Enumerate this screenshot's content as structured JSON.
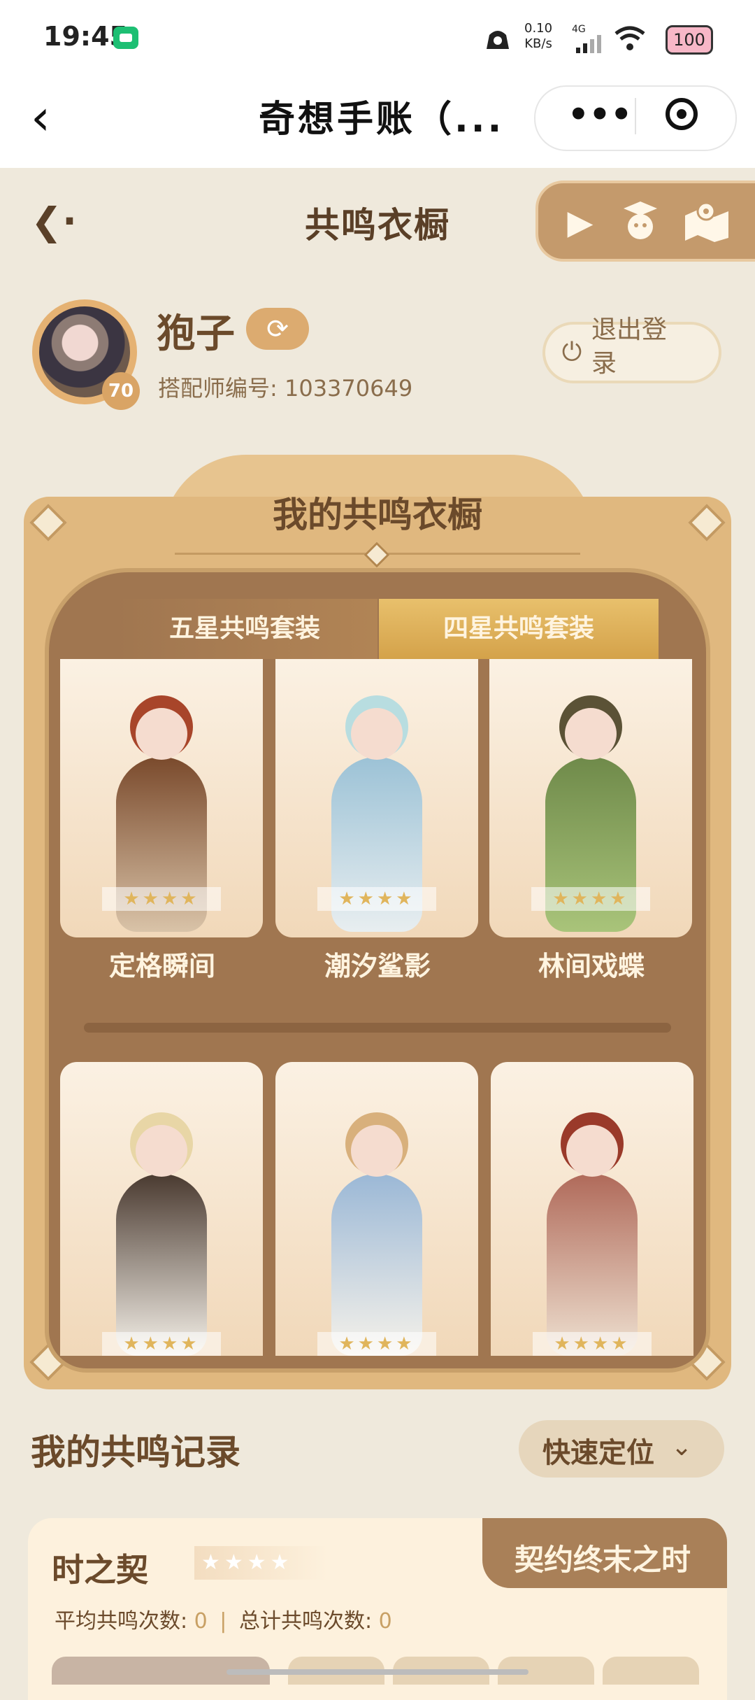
{
  "status_bar": {
    "time": "19:45",
    "net_speed_value": "0.10",
    "net_speed_unit": "KB/s",
    "signal": "4G",
    "battery": "100"
  },
  "header": {
    "back_icon": "chevron-left-icon",
    "title": "奇想手账（...",
    "more_icon": "more-dots-icon",
    "target_icon": "target-icon"
  },
  "page": {
    "title": "共鸣衣橱",
    "back_icon": "arrow-back-icon"
  },
  "toolbar": {
    "icons": [
      "play-icon",
      "mascot-icon",
      "map-icon"
    ]
  },
  "profile": {
    "username": "狍子",
    "level": "70",
    "stylist_label": "搭配师编号:",
    "stylist_id": "103370649",
    "logout_label": "退出登录"
  },
  "wardrobe": {
    "title": "我的共鸣衣橱",
    "tabs": [
      {
        "label": "五星共鸣套装",
        "active": false
      },
      {
        "label": "四星共鸣套装",
        "active": true
      }
    ],
    "items": [
      {
        "name": "定格瞬间",
        "stars": "★★★★"
      },
      {
        "name": "潮汐鲨影",
        "stars": "★★★★"
      },
      {
        "name": "林间戏蝶",
        "stars": "★★★★"
      },
      {
        "name": "",
        "stars": "★★★★"
      },
      {
        "name": "",
        "stars": "★★★★"
      },
      {
        "name": "",
        "stars": "★★★★"
      }
    ]
  },
  "records": {
    "title": "我的共鸣记录",
    "locate_label": "快速定位",
    "card": {
      "name": "时之契",
      "stars": "★★★★",
      "tab_label": "契约终末之时",
      "avg_label": "平均共鸣次数:",
      "avg_value": "0",
      "total_label": "总计共鸣次数:",
      "total_value": "0"
    }
  },
  "colors": {
    "accent": "#d4a24a",
    "panel": "#e0b87f",
    "background": "#efe9dc"
  }
}
